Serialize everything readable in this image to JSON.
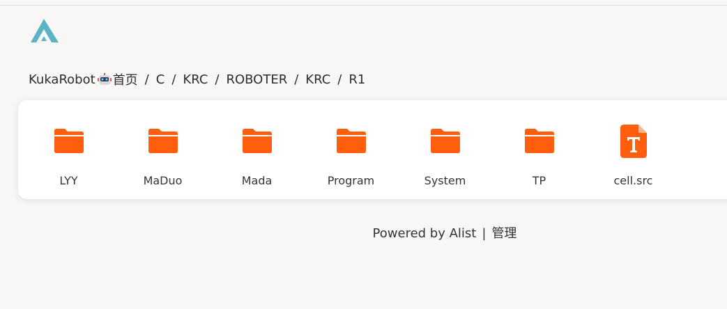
{
  "breadcrumb": {
    "site_name": "KukaRobot",
    "home": "首页",
    "separator": "/",
    "segments": [
      "C",
      "KRC",
      "ROBOTER",
      "KRC",
      "R1"
    ]
  },
  "files": [
    {
      "name": "LYY",
      "type": "folder"
    },
    {
      "name": "MaDuo",
      "type": "folder"
    },
    {
      "name": "Mada",
      "type": "folder"
    },
    {
      "name": "Program",
      "type": "folder"
    },
    {
      "name": "System",
      "type": "folder"
    },
    {
      "name": "TP",
      "type": "folder"
    },
    {
      "name": "cell.src",
      "type": "text-file"
    }
  ],
  "footer": {
    "powered_by": "Powered by Alist",
    "divider": "|",
    "manage_link": "管理"
  },
  "icons": {
    "logo": "alist-logo-icon",
    "robot": "robot-icon",
    "folder": "folder-icon",
    "text_file": "text-file-icon"
  },
  "colors": {
    "background": "#f8f7f6",
    "accent_orange": "#ff5e0e",
    "logo_teal": "#5bb3c4"
  }
}
